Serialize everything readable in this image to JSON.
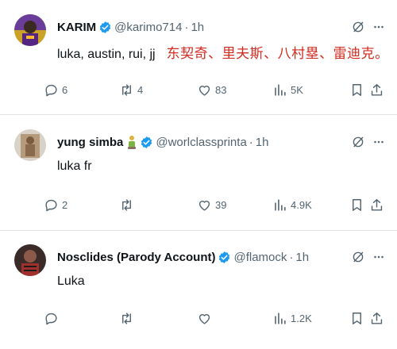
{
  "tweets": [
    {
      "name": "KARIM",
      "handle": "@karimo714",
      "time": "1h",
      "text": "luka, austin, rui, jj",
      "text_translation": "东契奇、里夫斯、八村塁、雷迪克。",
      "replies": "6",
      "retweets": "4",
      "likes": "83",
      "views": "5K"
    },
    {
      "name": "yung simba",
      "handle": "@worlclassprinta",
      "time": "1h",
      "text": "luka fr",
      "replies": "2",
      "retweets": "",
      "likes": "39",
      "views": "4.9K"
    },
    {
      "name": "Nosclides (Parody Account)",
      "handle": "@flamock",
      "time": "1h",
      "text": "Luka",
      "replies": "",
      "retweets": "",
      "likes": "",
      "views": "1.2K"
    }
  ],
  "separator": "·",
  "colors": {
    "text": "#0f1419",
    "muted": "#536471",
    "verified": "#1d9bf0",
    "translation": "#d22b1f",
    "divider": "#dfe3e6"
  },
  "icons": [
    "verified-badge-icon",
    "grok-icon",
    "more-icon",
    "reply-icon",
    "retweet-icon",
    "like-icon",
    "views-icon",
    "bookmark-icon",
    "share-icon"
  ]
}
